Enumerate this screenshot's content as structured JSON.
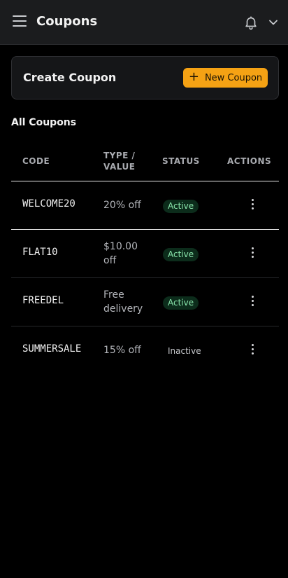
{
  "header": {
    "title": "Coupons"
  },
  "create_card": {
    "title": "Create Coupon",
    "new_button_label": "New Coupon"
  },
  "list": {
    "title": "All Coupons",
    "columns": {
      "code": "CODE",
      "type_value": "TYPE / VALUE",
      "status": "STATUS",
      "actions": "ACTIONS"
    },
    "rows": [
      {
        "code": "WELCOME20",
        "value": "20% off",
        "status": "Active"
      },
      {
        "code": "FLAT10",
        "value": "$10.00 off",
        "status": "Active"
      },
      {
        "code": "FREEDEL",
        "value": "Free delivery",
        "status": "Active"
      },
      {
        "code": "SUMMERSALE",
        "value": "15% off",
        "status": "Inactive"
      }
    ]
  },
  "colors": {
    "accent": "#f5a214",
    "active_bg": "#0c2c1b",
    "active_text": "#8ae6ac",
    "background": "#000000"
  },
  "icons": [
    "menu-icon",
    "bell-icon",
    "chevron-down-icon",
    "plus-icon",
    "more-vertical-icon"
  ]
}
